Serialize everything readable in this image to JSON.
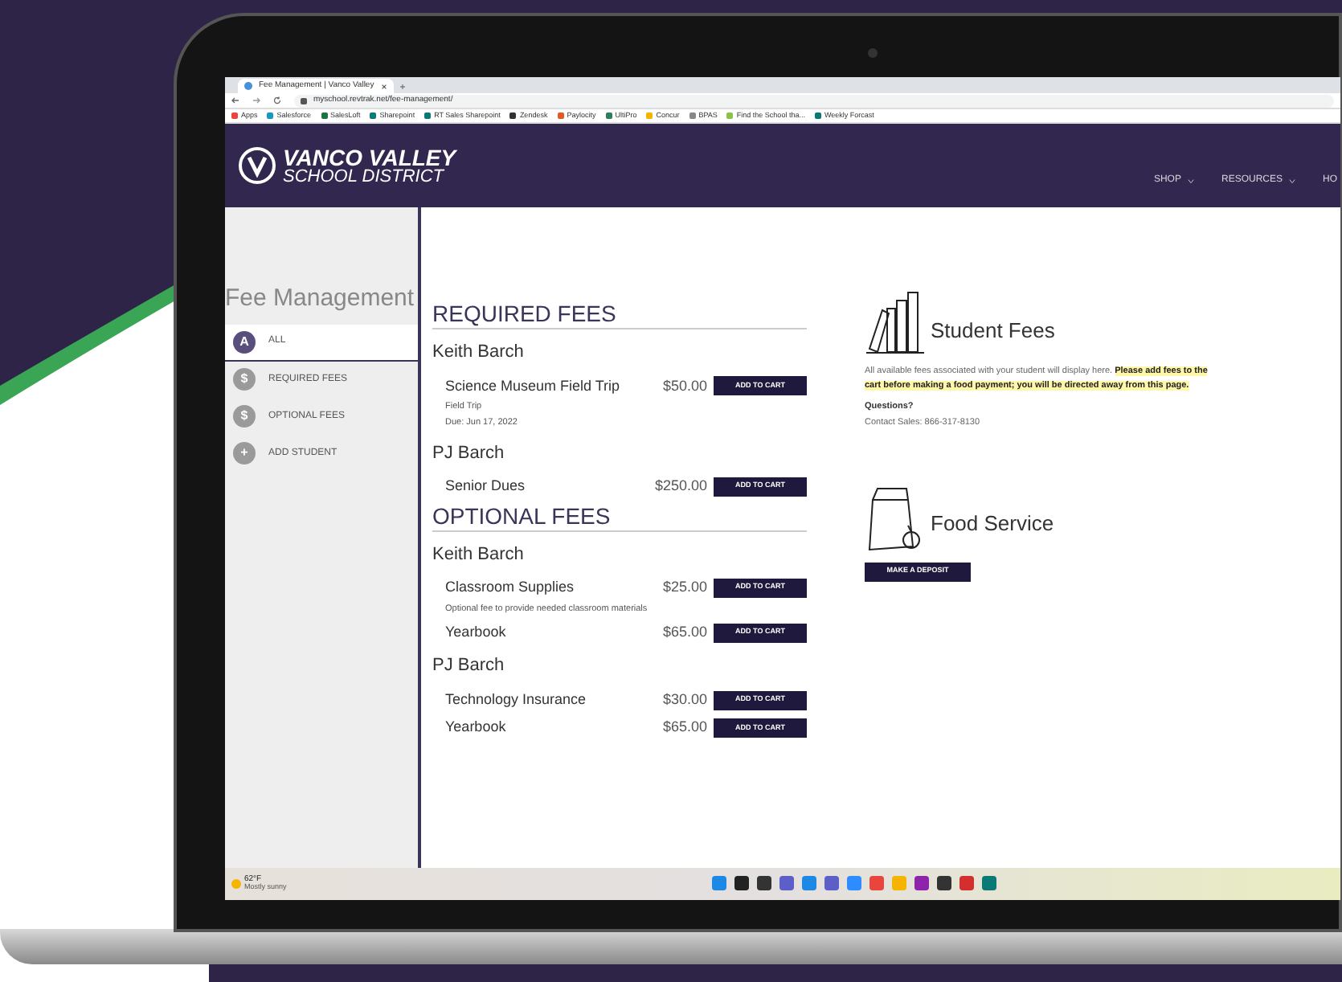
{
  "browser": {
    "tab_title": "Fee Management | Vanco Valley",
    "new_tab": "+",
    "url": "myschool.revtrak.net/fee-management/",
    "bookmarks": [
      "Apps",
      "Salesforce",
      "SalesLoft",
      "Sharepoint",
      "RT Sales Sharepoint",
      "Zendesk",
      "Paylocity",
      "UltiPro",
      "Concur",
      "BPAS",
      "Find the School tha...",
      "Weekly Forcast"
    ]
  },
  "header": {
    "logo_title": "VANCO VALLEY",
    "logo_subtitle": "SCHOOL DISTRICT",
    "nav": [
      "SHOP",
      "RESOURCES",
      "HO"
    ]
  },
  "sidebar": {
    "title": "Fee Management",
    "items": [
      {
        "icon_text": "A",
        "label": "ALL",
        "selected": true
      },
      {
        "icon_text": "$",
        "label": "REQUIRED FEES",
        "selected": false
      },
      {
        "icon_text": "$",
        "label": "OPTIONAL FEES",
        "selected": false
      },
      {
        "icon_text": "+",
        "label": "ADD STUDENT",
        "selected": false
      }
    ]
  },
  "sections": [
    {
      "title": "REQUIRED FEES",
      "students": [
        {
          "name": "Keith Barch",
          "items": [
            {
              "name": "Science Museum Field Trip",
              "price": "$50.00",
              "button": "ADD TO CART",
              "details": [
                "Field Trip",
                "Due: Jun 17, 2022"
              ]
            }
          ]
        },
        {
          "name": "PJ Barch",
          "items": [
            {
              "name": "Senior Dues",
              "price": "$250.00",
              "button": "ADD TO CART"
            }
          ]
        }
      ]
    },
    {
      "title": "OPTIONAL FEES",
      "students": [
        {
          "name": "Keith Barch",
          "items": [
            {
              "name": "Classroom Supplies",
              "price": "$25.00",
              "button": "ADD TO CART",
              "details": [
                "Optional fee to provide needed classroom materials"
              ]
            },
            {
              "name": "Yearbook",
              "price": "$65.00",
              "button": "ADD TO CART"
            }
          ]
        },
        {
          "name": "PJ Barch",
          "items": [
            {
              "name": "Technology Insurance",
              "price": "$30.00",
              "button": "ADD TO CART"
            },
            {
              "name": "Yearbook",
              "price": "$65.00",
              "button": "ADD TO CART"
            }
          ]
        }
      ]
    }
  ],
  "student_fees": {
    "title": "Student Fees",
    "text": "All available fees associated with your student will display here. **Please add fees to the cart before making a food payment; you will be directed away from this page.**",
    "questions": "Questions?",
    "contact": "Contact Sales: 866-317-8130"
  },
  "food_service": {
    "title": "Food Service",
    "button": "MAKE A DEPOSIT"
  },
  "taskbar": {
    "temperature": "62°F",
    "weather": "Mostly sunny"
  }
}
